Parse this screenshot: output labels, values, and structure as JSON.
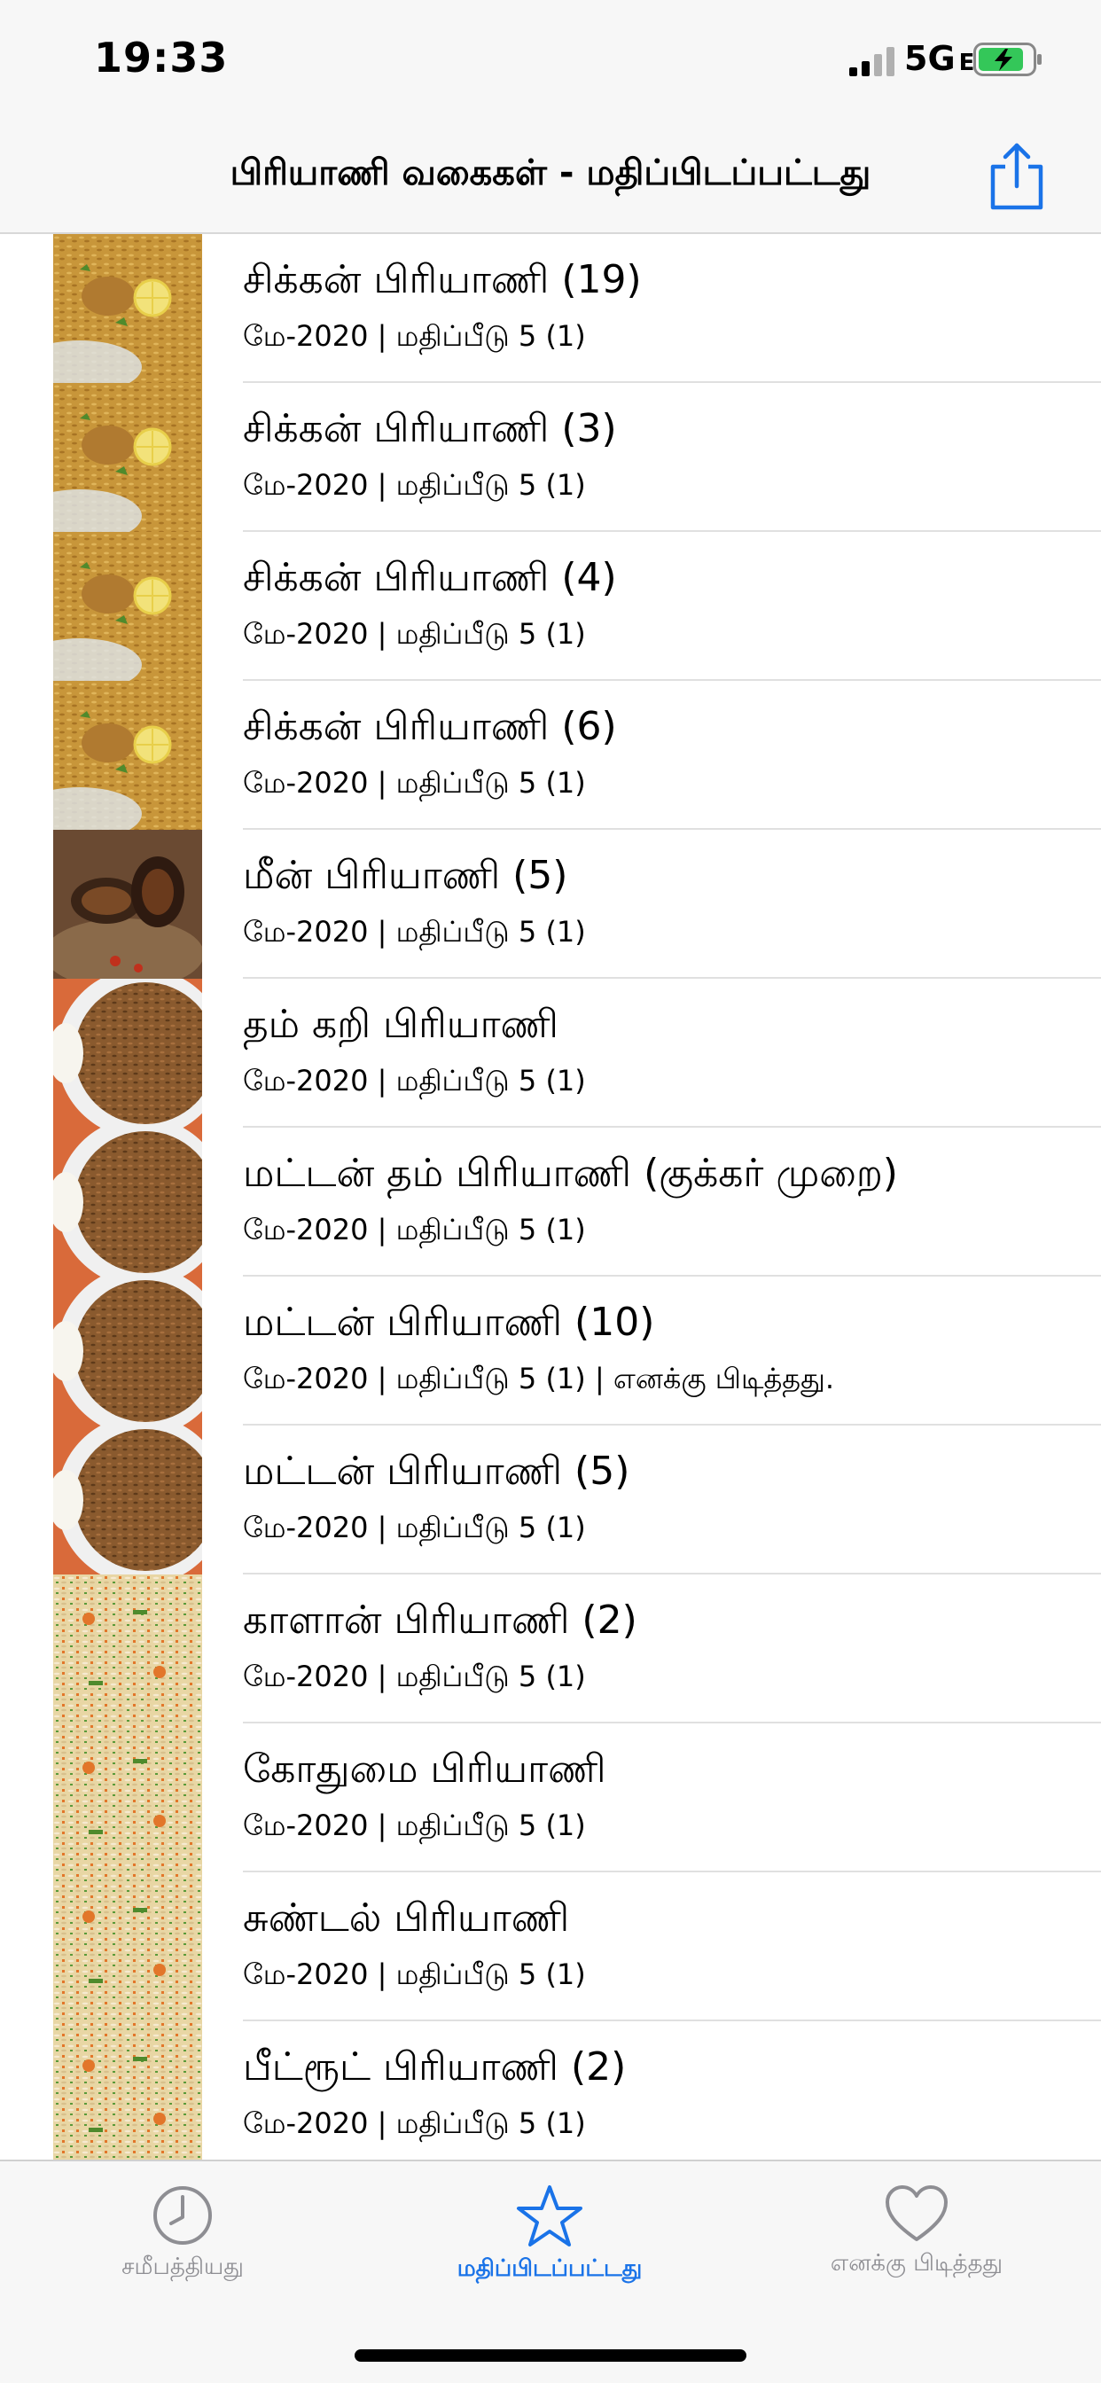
{
  "status": {
    "time": "19:33",
    "network": "5G",
    "network_suffix": "E"
  },
  "nav": {
    "title": "பிரியாணி வகைகள் - மதிப்பிடப்பட்டது",
    "share_icon": "share-icon"
  },
  "colors": {
    "accent": "#1a73e8",
    "battery": "#34c759"
  },
  "items": [
    {
      "title": "சிக்கன் பிரியாணி (19)",
      "subtitle": "மே-2020 | மதிப்பீடு 5 (1)",
      "thumb": "chicken"
    },
    {
      "title": "சிக்கன் பிரியாணி (3)",
      "subtitle": "மே-2020 | மதிப்பீடு 5 (1)",
      "thumb": "chicken"
    },
    {
      "title": "சிக்கன் பிரியாணி (4)",
      "subtitle": "மே-2020 | மதிப்பீடு 5 (1)",
      "thumb": "chicken"
    },
    {
      "title": "சிக்கன் பிரியாணி (6)",
      "subtitle": "மே-2020 | மதிப்பீடு 5 (1)",
      "thumb": "chicken"
    },
    {
      "title": "மீன் பிரியாணி (5)",
      "subtitle": "மே-2020 | மதிப்பீடு 5 (1)",
      "thumb": "fish"
    },
    {
      "title": "தம் கறி பிரியாணி",
      "subtitle": "மே-2020 | மதிப்பீடு 5 (1)",
      "thumb": "mutton"
    },
    {
      "title": "மட்டன் தம் பிரியாணி (குக்கர் முறை)",
      "subtitle": "மே-2020 | மதிப்பீடு 5 (1)",
      "thumb": "mutton"
    },
    {
      "title": "மட்டன் பிரியாணி (10)",
      "subtitle": "மே-2020 | மதிப்பீடு 5 (1)  | எனக்கு பிடித்தது.",
      "thumb": "mutton"
    },
    {
      "title": "மட்டன் பிரியாணி (5)",
      "subtitle": "மே-2020 | மதிப்பீடு 5 (1)",
      "thumb": "mutton"
    },
    {
      "title": "காளான் பிரியாணி (2)",
      "subtitle": "மே-2020 | மதிப்பீடு 5 (1)",
      "thumb": "veg"
    },
    {
      "title": "கோதுமை பிரியாணி",
      "subtitle": "மே-2020 | மதிப்பீடு 5 (1)",
      "thumb": "veg"
    },
    {
      "title": "சுண்டல் பிரியாணி",
      "subtitle": "மே-2020 | மதிப்பீடு 5 (1)",
      "thumb": "veg"
    },
    {
      "title": "பீட்ரூட் பிரியாணி (2)",
      "subtitle": "மே-2020 | மதிப்பீடு 5 (1)",
      "thumb": "veg"
    }
  ],
  "tabs": [
    {
      "label": "சமீபத்தியது",
      "icon": "clock-icon",
      "active": false
    },
    {
      "label": "மதிப்பிடப்பட்டது",
      "icon": "star-icon",
      "active": true
    },
    {
      "label": "எனக்கு பிடித்தது",
      "icon": "heart-icon",
      "active": false
    }
  ]
}
